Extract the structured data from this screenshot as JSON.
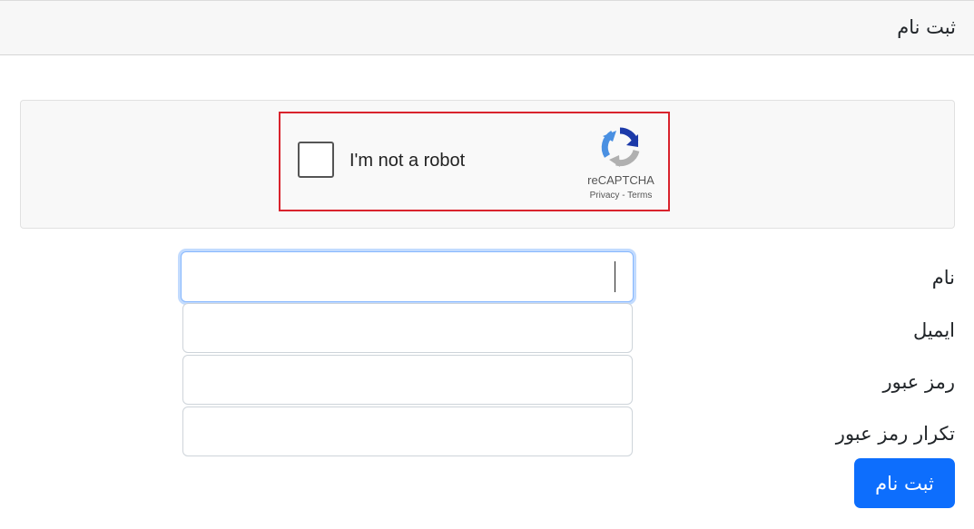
{
  "header": {
    "title": "ثبت نام"
  },
  "recaptcha": {
    "checkbox_label": "I'm not a robot",
    "brand": "reCAPTCHA",
    "privacy_link": "Privacy",
    "separator": " - ",
    "terms_link": "Terms",
    "logo_icon": "recaptcha-logo-icon",
    "highlight_color": "#d9232d"
  },
  "form": {
    "fields": [
      {
        "label": "نام",
        "value": ""
      },
      {
        "label": "ایمیل",
        "value": ""
      },
      {
        "label": "رمز عبور",
        "value": ""
      },
      {
        "label": "تکرار رمز عبور",
        "value": ""
      }
    ],
    "submit_label": "ثبت نام",
    "accent_color": "#0d6efd"
  }
}
